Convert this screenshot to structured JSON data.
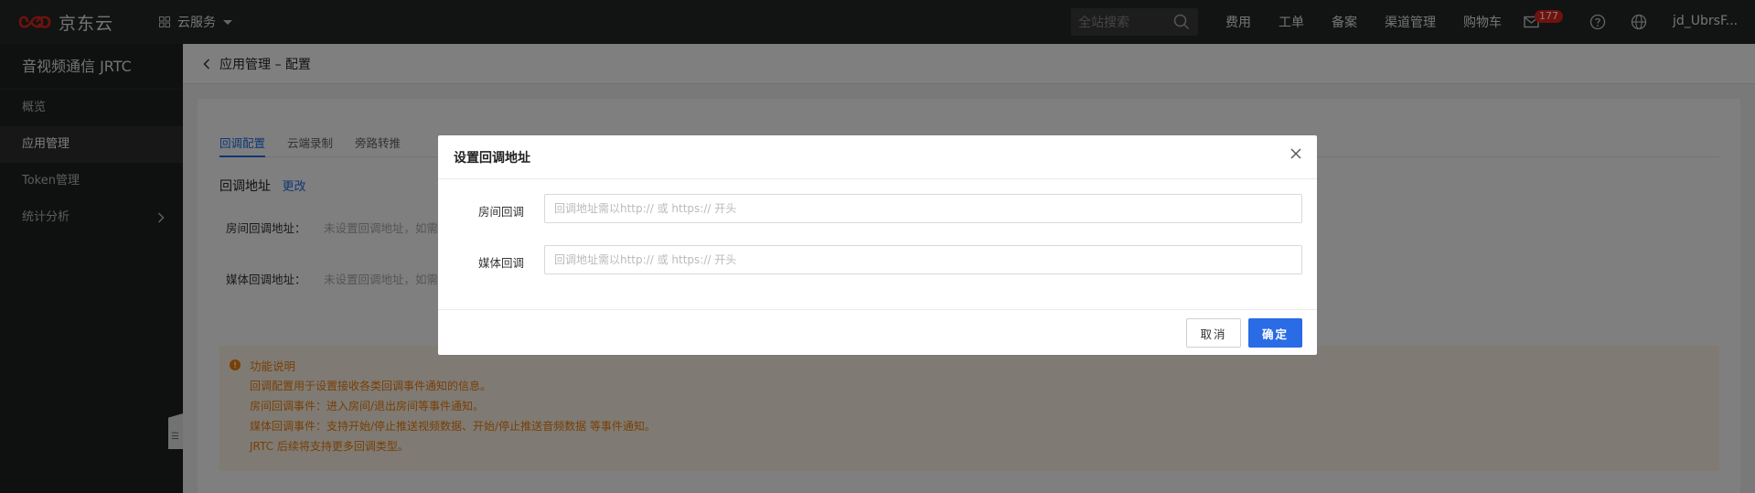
{
  "topbar": {
    "brand": "京东云",
    "cloud_menu": "云服务",
    "search_placeholder": "全站搜索",
    "links": [
      "费用",
      "工单",
      "备案",
      "渠道管理",
      "购物车"
    ],
    "mail_badge": "177",
    "username": "jd_UbrsF..."
  },
  "sidebar": {
    "title": "音视频通信 JRTC",
    "items": [
      {
        "label": "概览",
        "active": false
      },
      {
        "label": "应用管理",
        "active": true
      },
      {
        "label": "Token管理",
        "active": false
      },
      {
        "label": "统计分析",
        "active": false,
        "expandable": true
      }
    ],
    "collapse_glyph": "☰"
  },
  "main": {
    "breadcrumb": "应用管理 – 配置",
    "tabs": [
      {
        "label": "回调配置",
        "active": true
      },
      {
        "label": "云端录制",
        "active": false
      },
      {
        "label": "旁路转推",
        "active": false
      }
    ],
    "section_title": "回调地址",
    "section_link": "更改",
    "rows": [
      {
        "label": "房间回调地址：",
        "value": "未设置回调地址，如需修"
      },
      {
        "label": "媒体回调地址：",
        "value": "未设置回调地址，如需修"
      }
    ],
    "notice": {
      "title": "功能说明",
      "lines": [
        "回调配置用于设置接收各类回调事件通知的信息。",
        "房间回调事件：进入房间/退出房间等事件通知。",
        "媒体回调事件：支持开始/停止推送视频数据、开始/停止推送音频数据 等事件通知。",
        "JRTC 后续将支持更多回调类型。"
      ]
    }
  },
  "modal": {
    "title": "设置回调地址",
    "fields": [
      {
        "label": "房间回调",
        "value": "",
        "placeholder": "回调地址需以http:// 或 https:// 开头"
      },
      {
        "label": "媒体回调",
        "value": "",
        "placeholder": "回调地址需以http:// 或 https:// 开头"
      }
    ],
    "cancel_label": "取消",
    "ok_label": "确定"
  },
  "colors": {
    "accent": "#2a6be6",
    "brand_red": "#e1251b",
    "notice_text": "#f07e0c",
    "notice_bg": "#fff6e8"
  }
}
